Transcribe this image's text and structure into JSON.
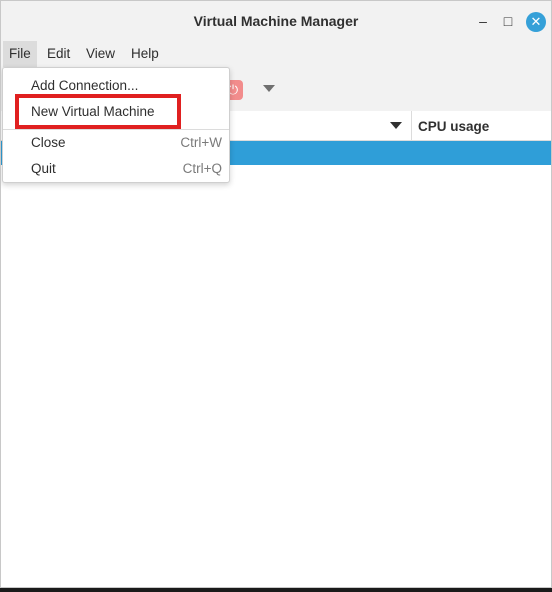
{
  "window": {
    "title": "Virtual Machine Manager"
  },
  "window_controls": {
    "minimize_glyph": "–",
    "maximize_glyph": "□",
    "close_glyph": "✕"
  },
  "menubar": {
    "items": [
      "File",
      "Edit",
      "View",
      "Help"
    ]
  },
  "toolbar": {
    "power_glyph": "⏻"
  },
  "columns": {
    "cpu_usage": "CPU usage"
  },
  "file_menu": {
    "items": [
      {
        "label": "Add Connection...",
        "accel": ""
      },
      {
        "label": "New Virtual Machine",
        "accel": ""
      },
      {
        "label": "Close",
        "accel": "Ctrl+W"
      },
      {
        "label": "Quit",
        "accel": "Ctrl+Q"
      }
    ]
  },
  "colors": {
    "selection": "#2f9ed8",
    "highlight": "#e02020",
    "close_button": "#35a0d8"
  }
}
